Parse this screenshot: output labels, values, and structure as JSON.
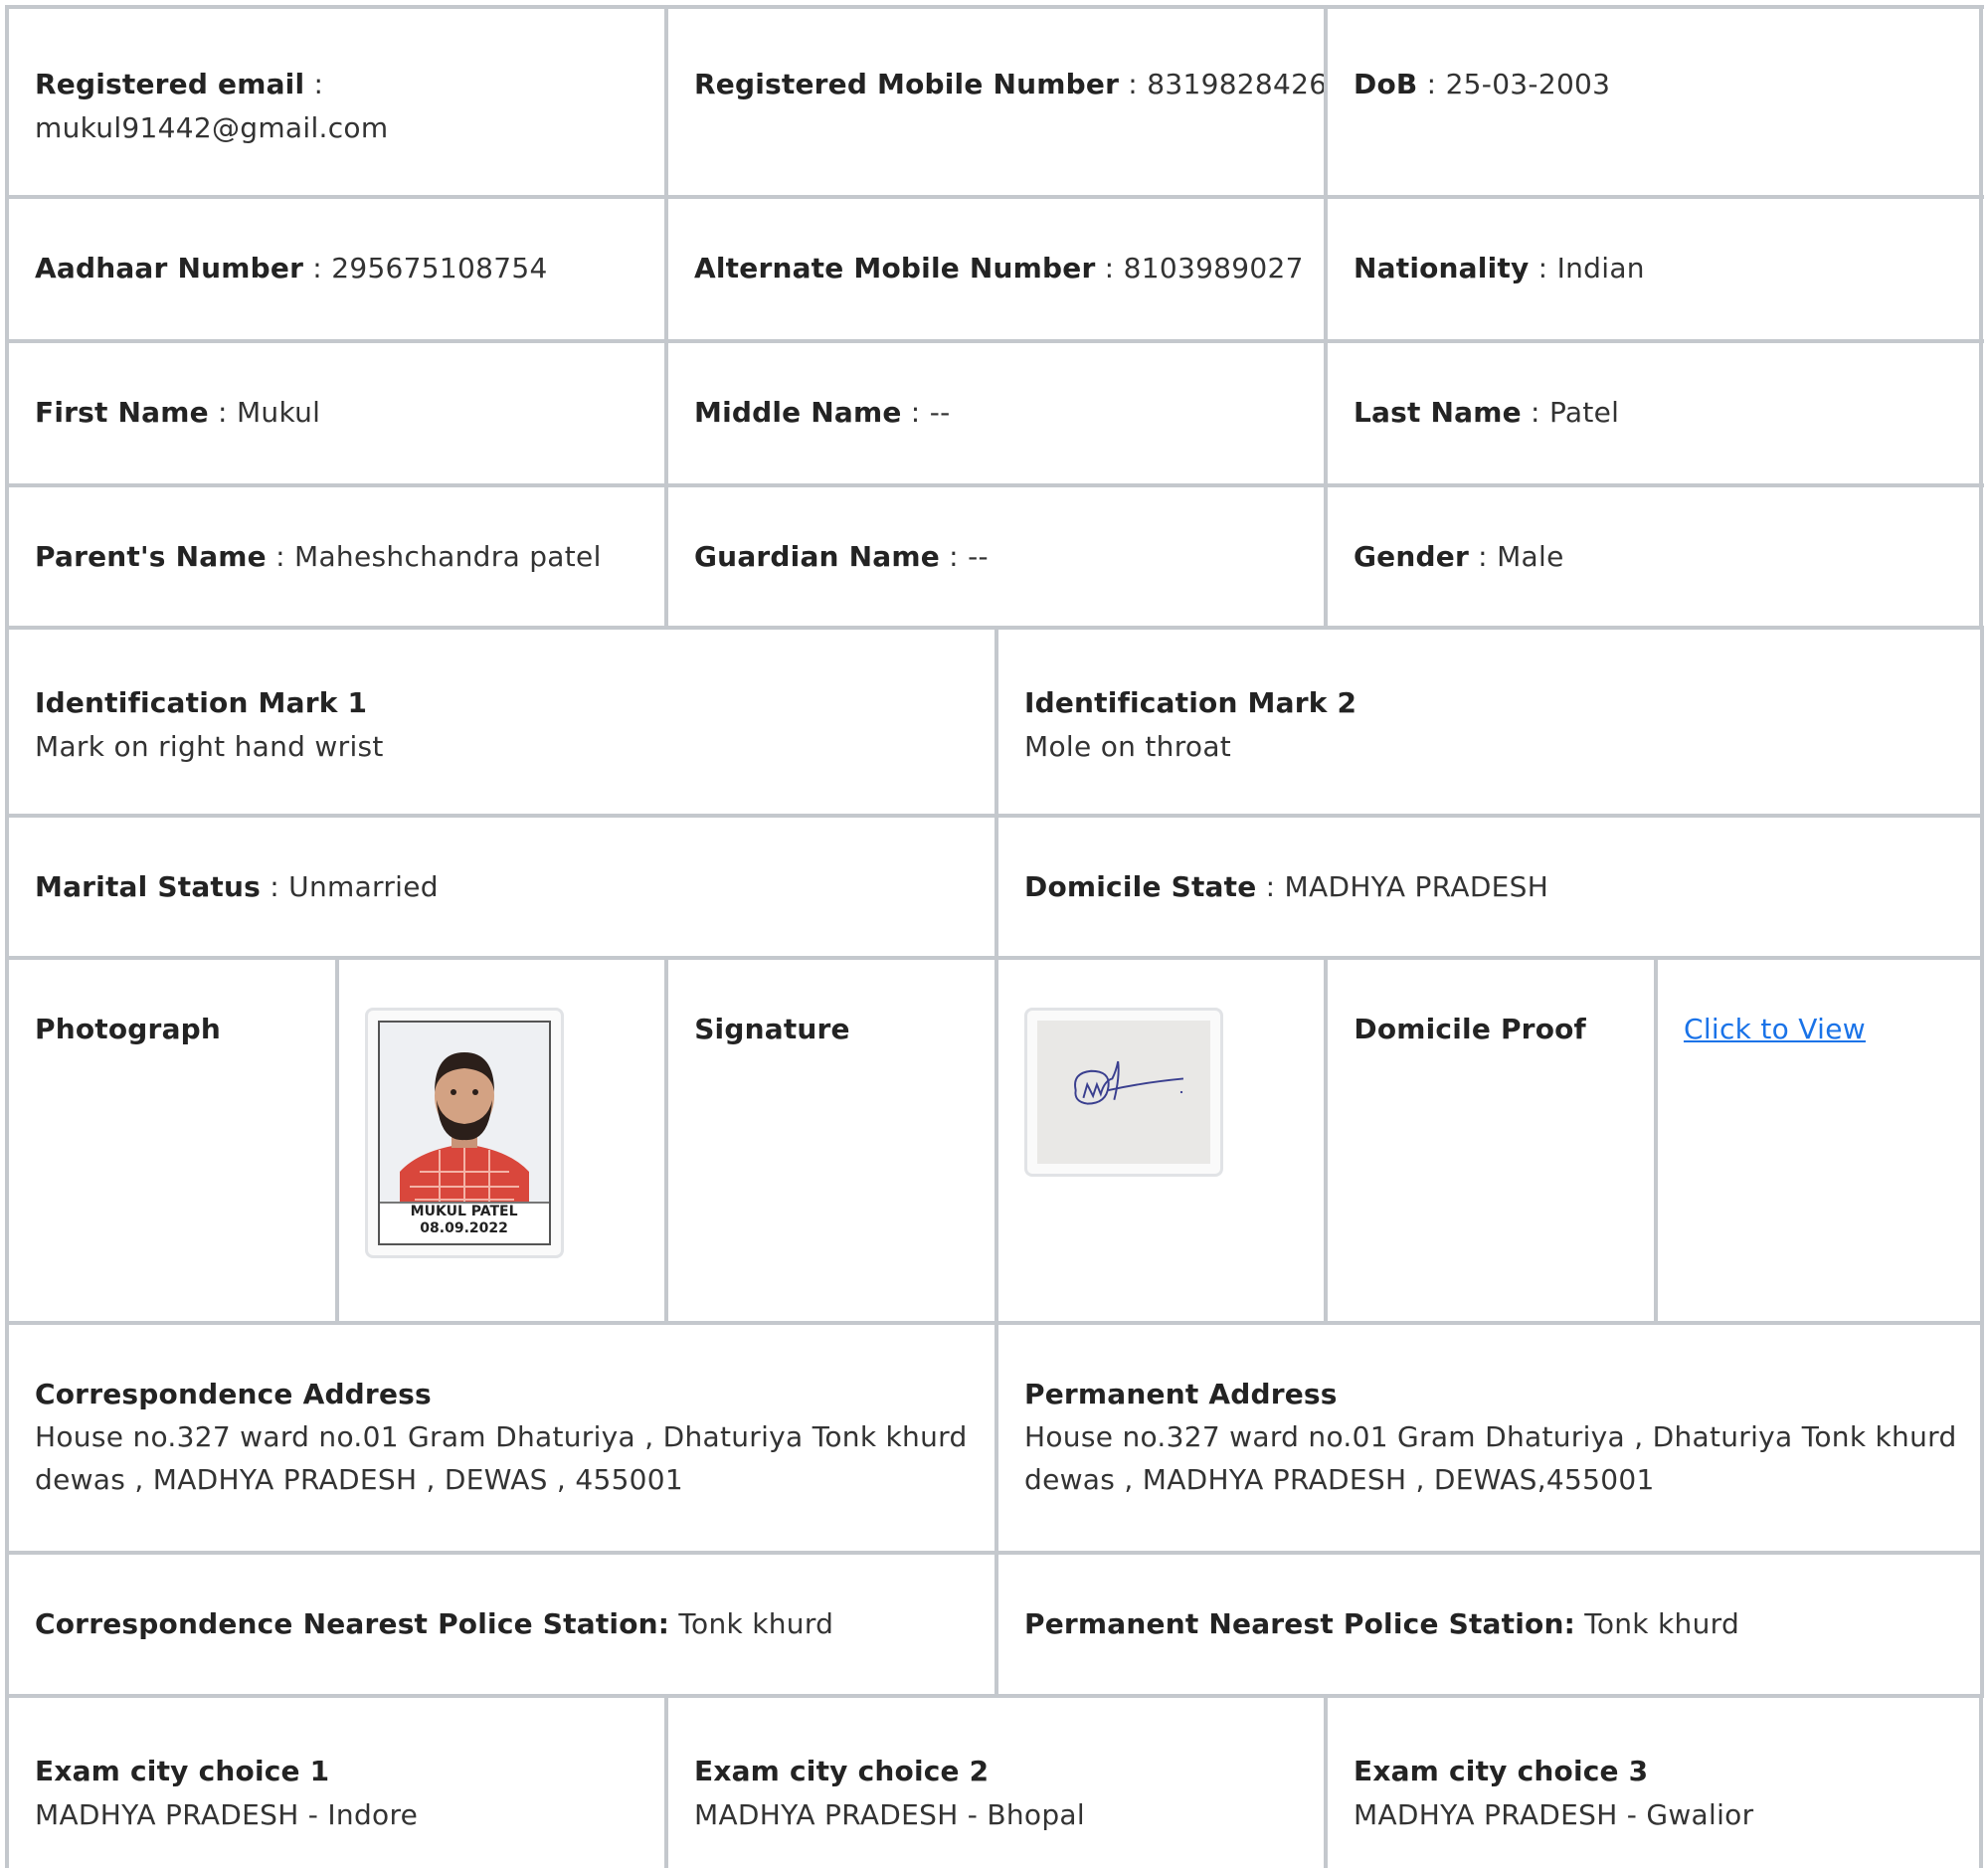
{
  "row1": {
    "email_label": "Registered email",
    "email_value": "mukul91442@gmail.com",
    "mobile_label": "Registered Mobile Number",
    "mobile_value": "8319828426",
    "dob_label": "DoB",
    "dob_value": "25-03-2003"
  },
  "row2": {
    "aadhaar_label": "Aadhaar Number",
    "aadhaar_value": "295675108754",
    "alt_mobile_label": "Alternate Mobile Number",
    "alt_mobile_value": "8103989027",
    "nationality_label": "Nationality",
    "nationality_value": "Indian"
  },
  "row3": {
    "first_label": "First Name",
    "first_value": "Mukul",
    "middle_label": "Middle Name",
    "middle_value": "--",
    "last_label": "Last Name",
    "last_value": "Patel"
  },
  "row4": {
    "parent_label": "Parent's Name",
    "parent_value": "Maheshchandra patel",
    "guardian_label": "Guardian Name",
    "guardian_value": "--",
    "gender_label": "Gender",
    "gender_value": "Male"
  },
  "row5": {
    "mark1_label": "Identification Mark 1",
    "mark1_value": "Mark on right hand wrist",
    "mark2_label": "Identification Mark 2",
    "mark2_value": "Mole on throat"
  },
  "row6": {
    "marital_label": "Marital Status",
    "marital_value": "Unmarried",
    "domicile_label": "Domicile State",
    "domicile_value": "MADHYA PRADESH"
  },
  "row7": {
    "photo_label": "Photograph",
    "photo_caption_name": "MUKUL PATEL",
    "photo_caption_date": "08.09.2022",
    "signature_label": "Signature",
    "domicile_proof_label": "Domicile Proof",
    "domicile_proof_link": "Click to View"
  },
  "row8": {
    "corr_label": "Correspondence Address",
    "corr_line1": "House no.327 ward no.01 Gram Dhaturiya , Dhaturiya Tonk khurd",
    "corr_line2": "dewas , MADHYA PRADESH , DEWAS , 455001",
    "perm_label": "Permanent Address",
    "perm_line1": "House no.327 ward no.01 Gram Dhaturiya , Dhaturiya Tonk khurd",
    "perm_line2": "dewas , MADHYA PRADESH , DEWAS,455001"
  },
  "row9": {
    "corr_police_label": "Correspondence Nearest Police Station:",
    "corr_police_value": "Tonk khurd",
    "perm_police_label": "Permanent Nearest Police Station:",
    "perm_police_value": "Tonk khurd"
  },
  "row10": {
    "city1_label": "Exam city choice 1",
    "city1_value": "MADHYA PRADESH - Indore",
    "city2_label": "Exam city choice 2",
    "city2_value": "MADHYA PRADESH - Bhopal",
    "city3_label": "Exam city choice 3",
    "city3_value": "MADHYA PRADESH - Gwalior"
  },
  "colors": {
    "border": "#c4c8cd",
    "link": "#1a73e8",
    "label": "#232323"
  }
}
